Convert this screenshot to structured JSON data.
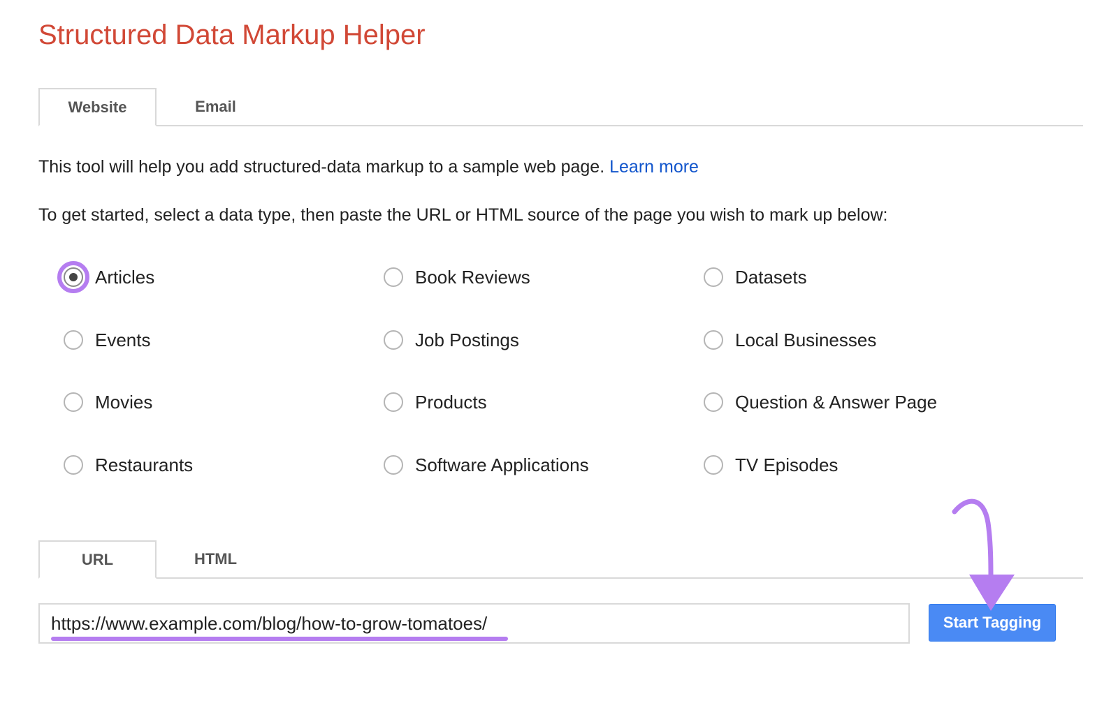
{
  "header": {
    "title": "Structured Data Markup Helper"
  },
  "main_tabs": [
    {
      "label": "Website",
      "active": true
    },
    {
      "label": "Email",
      "active": false
    }
  ],
  "intro": {
    "text": "This tool will help you add structured-data markup to a sample web page. ",
    "link_label": "Learn more"
  },
  "instructions": "To get started, select a data type, then paste the URL or HTML source of the page you wish to mark up below:",
  "data_types": [
    {
      "label": "Articles",
      "checked": true
    },
    {
      "label": "Book Reviews",
      "checked": false
    },
    {
      "label": "Datasets",
      "checked": false
    },
    {
      "label": "Events",
      "checked": false
    },
    {
      "label": "Job Postings",
      "checked": false
    },
    {
      "label": "Local Businesses",
      "checked": false
    },
    {
      "label": "Movies",
      "checked": false
    },
    {
      "label": "Products",
      "checked": false
    },
    {
      "label": "Question & Answer Page",
      "checked": false
    },
    {
      "label": "Restaurants",
      "checked": false
    },
    {
      "label": "Software Applications",
      "checked": false
    },
    {
      "label": "TV Episodes",
      "checked": false
    }
  ],
  "source_tabs": [
    {
      "label": "URL",
      "active": true
    },
    {
      "label": "HTML",
      "active": false
    }
  ],
  "url_input": {
    "value": "https://www.example.com/blog/how-to-grow-tomatoes/"
  },
  "submit": {
    "label": "Start Tagging"
  },
  "colors": {
    "title": "#d14836",
    "link": "#1155cc",
    "button": "#4a8af4",
    "annotation": "#b57df0"
  }
}
